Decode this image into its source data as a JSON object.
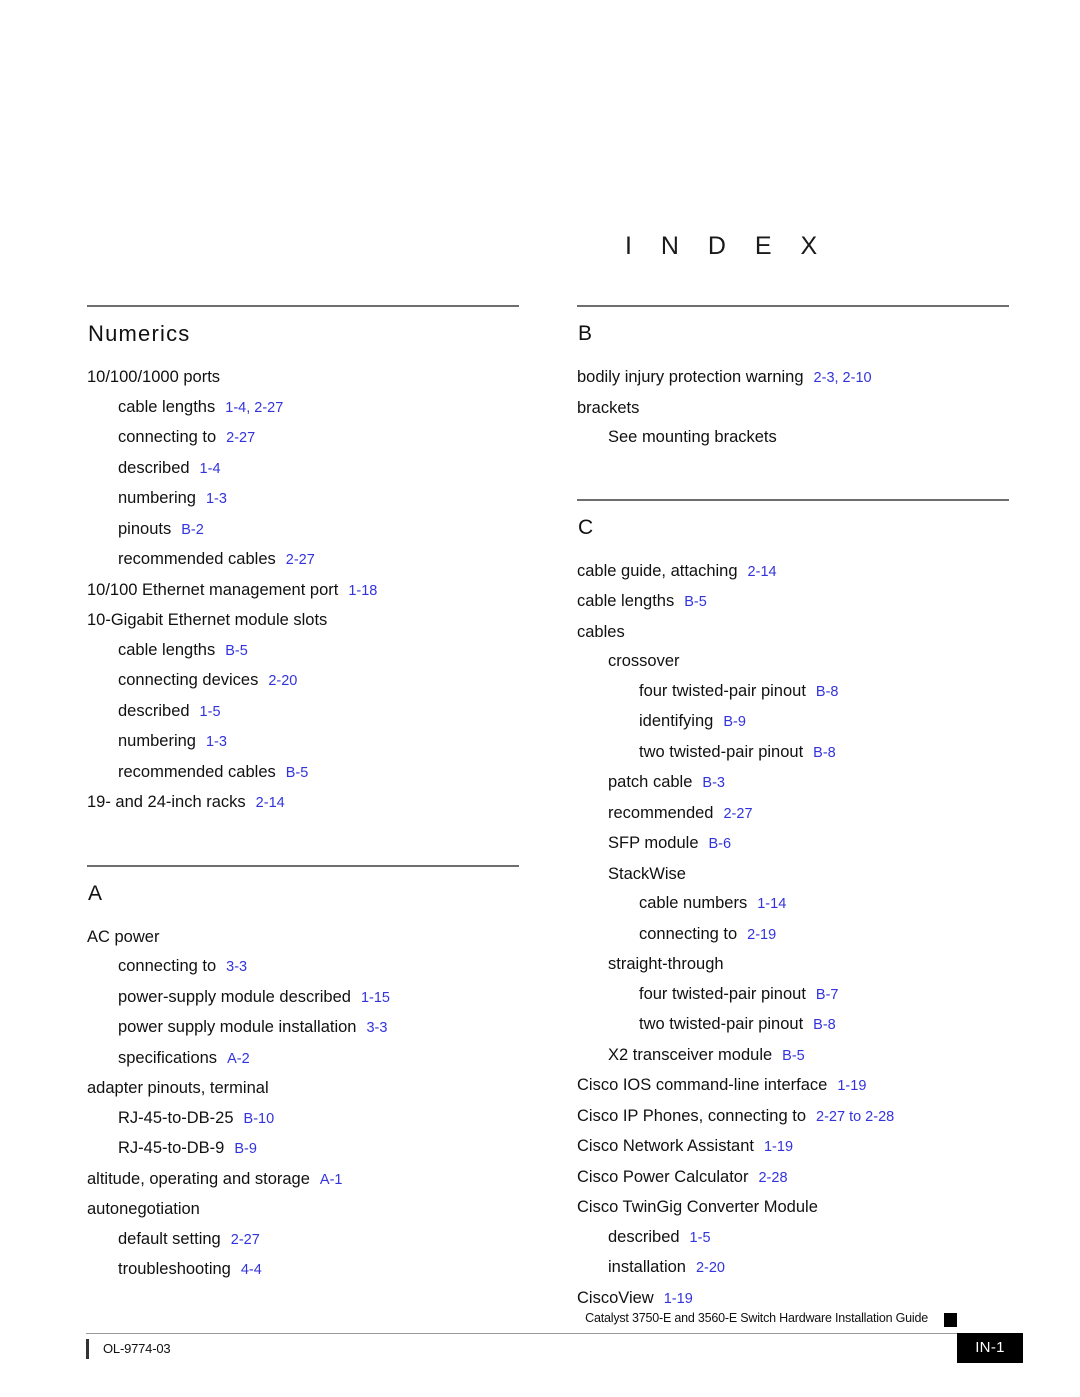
{
  "document": {
    "index_title": "I N D E X",
    "footer": {
      "guide_title": "Catalyst 3750-E and 3560-E Switch Hardware Installation Guide",
      "doc_id": "OL-9774-03",
      "page_number": "IN-1"
    },
    "link_color": "#3333dd"
  },
  "columns": [
    {
      "name": "left",
      "sections": [
        {
          "heading": "Numerics",
          "entries": [
            {
              "level": 0,
              "label": "10/100/1000 ports",
              "pages": ""
            },
            {
              "level": 1,
              "label": "cable lengths",
              "pages": "1-4, 2-27"
            },
            {
              "level": 1,
              "label": "connecting to",
              "pages": "2-27"
            },
            {
              "level": 1,
              "label": "described",
              "pages": "1-4"
            },
            {
              "level": 1,
              "label": "numbering",
              "pages": "1-3"
            },
            {
              "level": 1,
              "label": "pinouts",
              "pages": "B-2"
            },
            {
              "level": 1,
              "label": "recommended cables",
              "pages": "2-27"
            },
            {
              "level": 0,
              "label": "10/100 Ethernet management port",
              "pages": "1-18"
            },
            {
              "level": 0,
              "label": "10-Gigabit Ethernet module slots",
              "pages": ""
            },
            {
              "level": 1,
              "label": "cable lengths",
              "pages": "B-5"
            },
            {
              "level": 1,
              "label": "connecting devices",
              "pages": "2-20"
            },
            {
              "level": 1,
              "label": "described",
              "pages": "1-5"
            },
            {
              "level": 1,
              "label": "numbering",
              "pages": "1-3"
            },
            {
              "level": 1,
              "label": "recommended cables",
              "pages": "B-5"
            },
            {
              "level": 0,
              "label": "19- and 24-inch racks",
              "pages": "2-14"
            }
          ]
        },
        {
          "heading": "A",
          "entries": [
            {
              "level": 0,
              "label": "AC power",
              "pages": ""
            },
            {
              "level": 1,
              "label": "connecting to",
              "pages": "3-3"
            },
            {
              "level": 1,
              "label": "power-supply module described",
              "pages": "1-15"
            },
            {
              "level": 1,
              "label": "power supply module installation",
              "pages": "3-3"
            },
            {
              "level": 1,
              "label": "specifications",
              "pages": "A-2"
            },
            {
              "level": 0,
              "label": "adapter pinouts, terminal",
              "pages": ""
            },
            {
              "level": 1,
              "label": "RJ-45-to-DB-25",
              "pages": "B-10"
            },
            {
              "level": 1,
              "label": "RJ-45-to-DB-9",
              "pages": "B-9"
            },
            {
              "level": 0,
              "label": "altitude, operating and storage",
              "pages": "A-1"
            },
            {
              "level": 0,
              "label": "autonegotiation",
              "pages": ""
            },
            {
              "level": 1,
              "label": "default setting",
              "pages": "2-27"
            },
            {
              "level": 1,
              "label": "troubleshooting",
              "pages": "4-4"
            }
          ]
        }
      ]
    },
    {
      "name": "right",
      "sections": [
        {
          "heading": "B",
          "entries": [
            {
              "level": 0,
              "label": "bodily injury protection warning",
              "pages": "2-3, 2-10"
            },
            {
              "level": 0,
              "label": "brackets",
              "pages": ""
            },
            {
              "level": 1,
              "label": "See mounting brackets",
              "pages": ""
            }
          ]
        },
        {
          "heading": "C",
          "entries": [
            {
              "level": 0,
              "label": "cable guide, attaching",
              "pages": "2-14"
            },
            {
              "level": 0,
              "label": "cable lengths",
              "pages": "B-5"
            },
            {
              "level": 0,
              "label": "cables",
              "pages": ""
            },
            {
              "level": 1,
              "label": "crossover",
              "pages": ""
            },
            {
              "level": 2,
              "label": "four twisted-pair pinout",
              "pages": "B-8"
            },
            {
              "level": 2,
              "label": "identifying",
              "pages": "B-9"
            },
            {
              "level": 2,
              "label": "two twisted-pair pinout",
              "pages": "B-8"
            },
            {
              "level": 1,
              "label": "patch cable",
              "pages": "B-3"
            },
            {
              "level": 1,
              "label": "recommended",
              "pages": "2-27"
            },
            {
              "level": 1,
              "label": "SFP module",
              "pages": "B-6"
            },
            {
              "level": 1,
              "label": "StackWise",
              "pages": ""
            },
            {
              "level": 2,
              "label": "cable numbers",
              "pages": "1-14"
            },
            {
              "level": 2,
              "label": "connecting to",
              "pages": "2-19"
            },
            {
              "level": 1,
              "label": "straight-through",
              "pages": ""
            },
            {
              "level": 2,
              "label": "four twisted-pair pinout",
              "pages": "B-7"
            },
            {
              "level": 2,
              "label": "two twisted-pair pinout",
              "pages": "B-8"
            },
            {
              "level": 1,
              "label": "X2 transceiver module",
              "pages": "B-5"
            },
            {
              "level": 0,
              "label": "Cisco IOS command-line interface",
              "pages": "1-19"
            },
            {
              "level": 0,
              "label": "Cisco IP Phones, connecting to",
              "pages": "2-27 to 2-28"
            },
            {
              "level": 0,
              "label": "Cisco Network Assistant",
              "pages": "1-19"
            },
            {
              "level": 0,
              "label": "Cisco Power Calculator",
              "pages": "2-28"
            },
            {
              "level": 0,
              "label": "Cisco TwinGig Converter Module",
              "pages": ""
            },
            {
              "level": 1,
              "label": "described",
              "pages": "1-5"
            },
            {
              "level": 1,
              "label": "installation",
              "pages": "2-20"
            },
            {
              "level": 0,
              "label": "CiscoView",
              "pages": "1-19"
            }
          ]
        }
      ]
    }
  ]
}
